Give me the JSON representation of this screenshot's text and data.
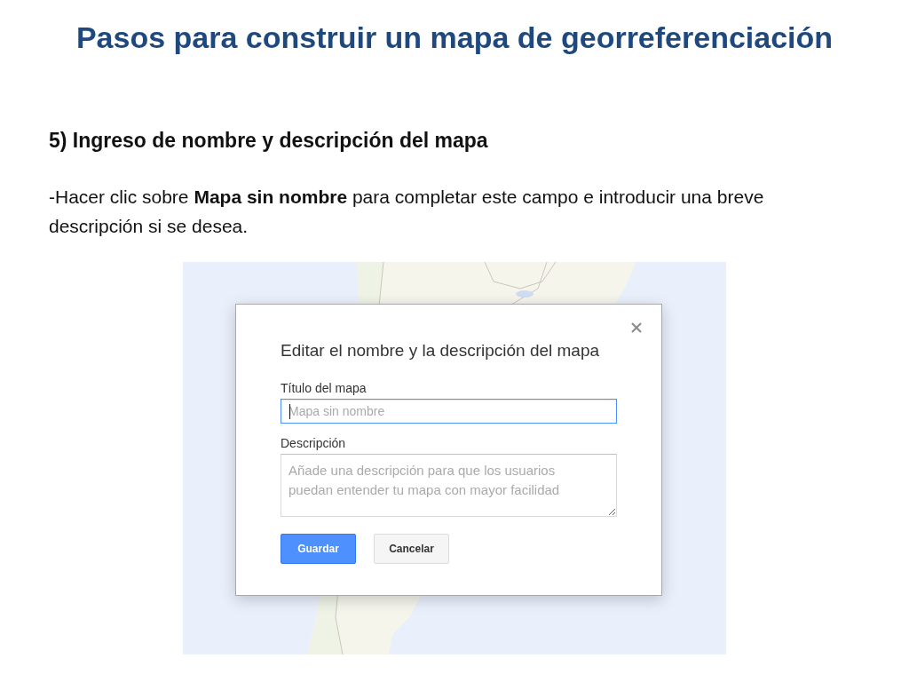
{
  "title": "Pasos para construir un mapa de georreferenciación",
  "step_heading": "5) Ingreso de nombre y descripción del mapa",
  "instruction": "-Hacer clic sobre **Mapa sin nombre** para completar este campo e introducir una breve descripción si se desea.",
  "screenshot": {
    "dialog": {
      "title": "Editar el nombre y la descripción del mapa",
      "fields": [
        {
          "kind": "text",
          "label": "Título del mapa",
          "placeholder": "Mapa sin nombre",
          "focused": true
        },
        {
          "kind": "textarea",
          "label": "Descripción",
          "placeholder": "Añade una descripción para que los usuarios puedan entender tu mapa con mayor facilidad",
          "focused": false
        }
      ],
      "buttons": [
        {
          "label": "Guardar",
          "primary": true
        },
        {
          "label": "Cancelar",
          "primary": false
        }
      ]
    }
  }
}
